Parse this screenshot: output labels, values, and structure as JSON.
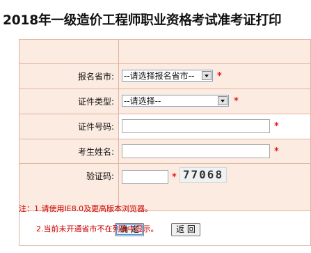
{
  "title": "2018年一级造价工程师职业资格考试准考证打印",
  "form": {
    "province": {
      "label": "报名省市:",
      "selected": "--请选择报名省市--",
      "required": "*"
    },
    "id_type": {
      "label": "证件类型:",
      "selected": "--请选择--",
      "required": "*"
    },
    "id_number": {
      "label": "证件号码:",
      "value": "",
      "required": "*"
    },
    "name": {
      "label": "考生姓名:",
      "value": "",
      "required": "*"
    },
    "captcha": {
      "label": "验证码:",
      "value": "",
      "required": "*",
      "image_text": "77068"
    }
  },
  "buttons": {
    "ok": "确 定",
    "back": "返 回"
  },
  "notes": {
    "line1": "注：1.请使用IE8.0及更高版本浏览器。",
    "line2": "2.当前未开通省市不在列表中显示。"
  },
  "colors": {
    "row_bg": "#fcebe0",
    "border": "#e0b3a1",
    "required_star": "#e02020",
    "note_text": "#cc0000"
  }
}
